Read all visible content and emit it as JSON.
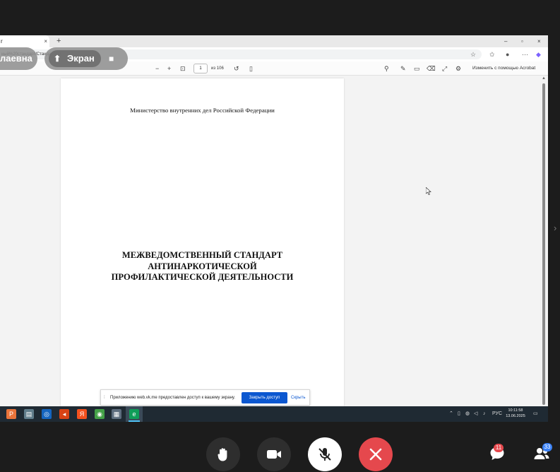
{
  "browser": {
    "tab_title": "r",
    "tab_close": "×",
    "new_tab": "+",
    "window_controls": [
      "–",
      "▫",
      "×"
    ],
    "address": "ный%20стандарт/Стандарт.pdf"
  },
  "pdf_toolbar": {
    "zoom_out": "−",
    "zoom_in": "+",
    "current_page": "1",
    "page_count": "из 106",
    "acrobat_label": "Изменить с помощью Acrobat"
  },
  "document": {
    "ministry": "Министерство внутренних дел Российской Федерации",
    "title_lines": [
      "МЕЖВЕДОМСТВЕННЫЙ СТАНДАРТ",
      "АНТИНАРКОТИЧЕСКОЙ",
      "ПРОФИЛАКТИЧЕСКОЙ ДЕЯТЕЛЬНОСТИ"
    ]
  },
  "share_notice": {
    "grip": "⁞",
    "text": "Приложению web.vk.me предоставлен доступ к вашему экрану.",
    "stop_button": "Закрыть доступ",
    "hide_link": "Скрыть"
  },
  "taskbar": {
    "language": "РУС",
    "time": "10:11:58",
    "date": "13.06.2025"
  },
  "call": {
    "participant_name": "лаевна",
    "screen_label": "Экран",
    "chat_badge": "11",
    "participants_badge": "33"
  },
  "colors": {
    "end_call": "#e5484d",
    "share_button": "#0b57d0",
    "badge": "#e5484d",
    "participants_badge": "#3b82f6"
  }
}
